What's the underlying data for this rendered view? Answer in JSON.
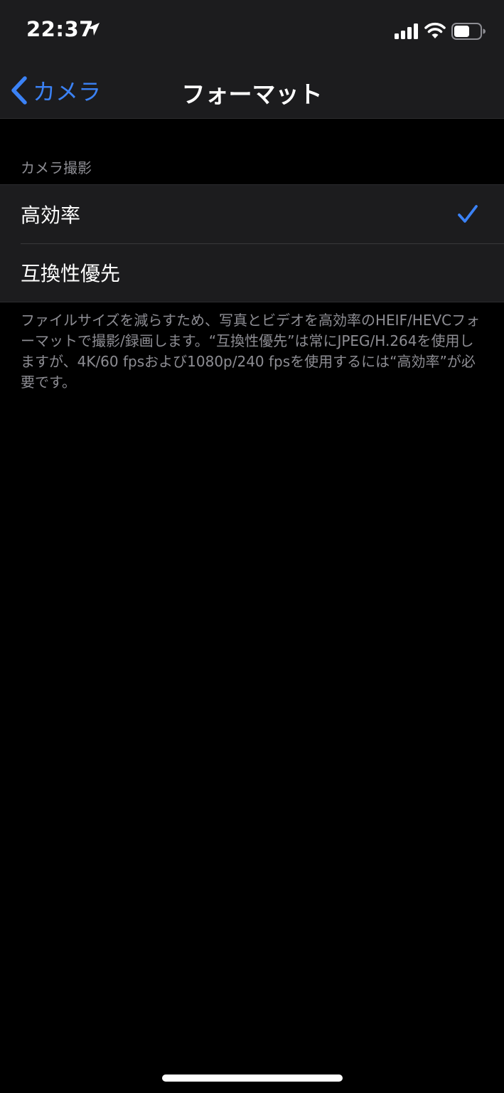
{
  "status_bar": {
    "time": "22:37",
    "icons": [
      "location-icon",
      "signal-icon",
      "wifi-icon",
      "battery-icon"
    ],
    "battery_level": 0.6
  },
  "nav": {
    "back_label": "カメラ",
    "back_icon": "chevron-left-icon",
    "title": "フォーマット"
  },
  "section": {
    "header": "カメラ撮影",
    "items": [
      {
        "label": "高効率",
        "selected": true
      },
      {
        "label": "互換性優先",
        "selected": false
      }
    ],
    "footer": "ファイルサイズを減らすため、写真とビデオを高効率のHEIF/HEVCフォーマットで撮影/録画します。“互換性優先”は常にJPEG/H.264を使用しますが、4K/60 fpsおよび1080p/240 fpsを使用するには“高効率”が必要です。"
  },
  "colors": {
    "accent": "#3b82f6",
    "background": "#000000",
    "cell": "#1c1c1e",
    "secondary_text": "#8d8d93"
  }
}
